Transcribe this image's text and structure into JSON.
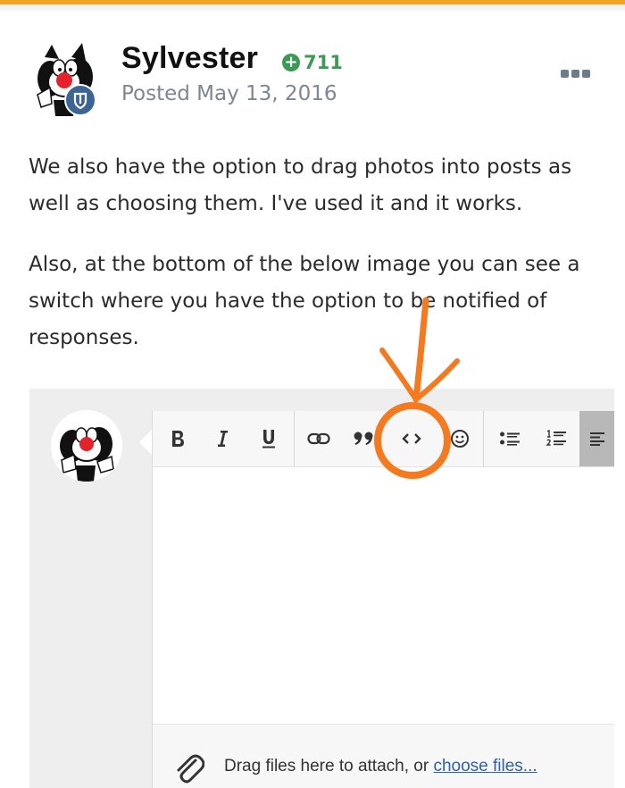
{
  "post": {
    "author": "Sylvester",
    "reputation": "711",
    "posted_label": "Posted May 13, 2016",
    "paragraphs": [
      "We also have the option to drag photos into posts as well as choosing them. I've used it and it works.",
      "Also, at the bottom of the below image you can see a switch where you have the option to be notified of responses."
    ]
  },
  "editor": {
    "toolbar": [
      "bold",
      "italic",
      "underline",
      "link",
      "quote",
      "code",
      "emoji",
      "bulleted-list",
      "numbered-list",
      "align"
    ],
    "attach_text": "Drag files here to attach, or ",
    "attach_link": "choose files..."
  },
  "colors": {
    "accent": "#f0a325",
    "reputation": "#3c9a55",
    "badge": "#3d6594",
    "annotation": "#f47a20",
    "link": "#2d62a4"
  }
}
